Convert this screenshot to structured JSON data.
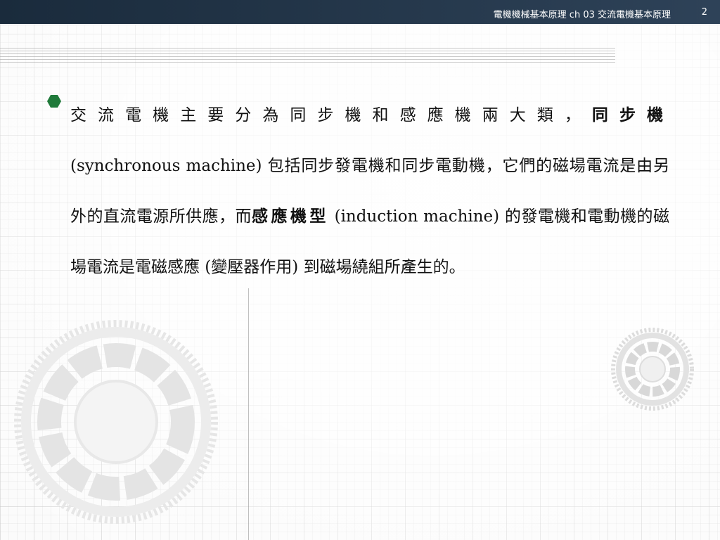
{
  "header": {
    "title": "電機機械基本原理 ch 03  交流電機基本原理",
    "page_number": "2"
  },
  "bullet": {
    "icon": "hexagon-bullet-icon",
    "color": "#1f7a3a",
    "segments": [
      "交流電機主要分為同步機和感應機兩大類，",
      "同步機",
      " (synchronous  machine)  包括同步發電機和同步電動機，它們的磁場電流是由另外的直流電源所供應，而",
      "感應機型",
      "  (induction machine)  的發電機和電動機的磁場電流是電磁感應  (變壓器作用) 到磁場繞組所產生的。"
    ]
  },
  "colors": {
    "header_bar": "#1f3246",
    "text": "#111111",
    "bullet": "#1f7a3a"
  }
}
